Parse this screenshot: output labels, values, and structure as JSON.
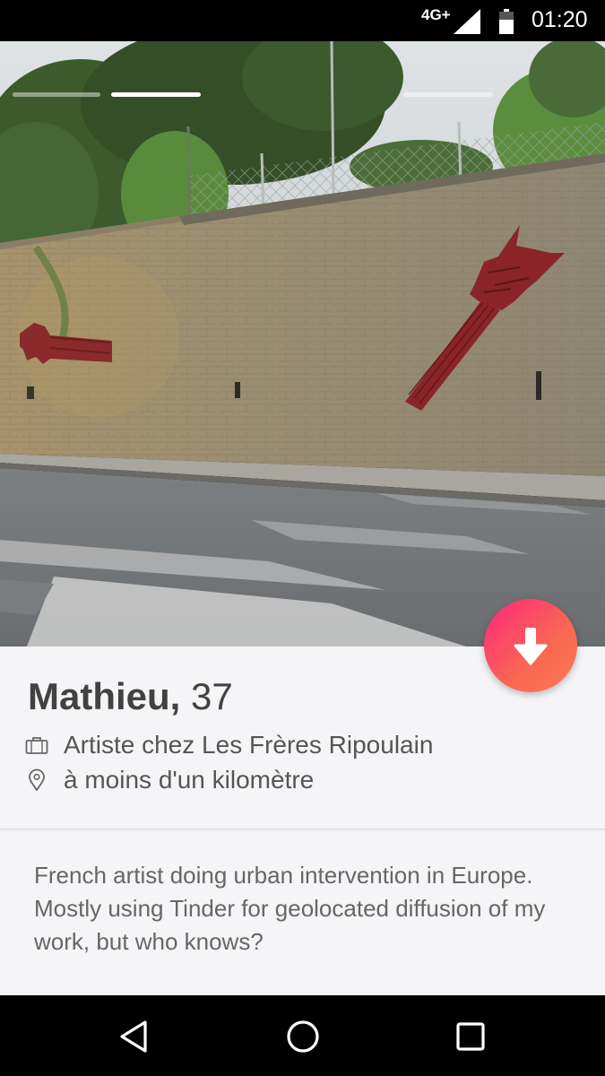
{
  "status_bar": {
    "network": "4G+",
    "time": "01:20",
    "signal_icon": "cell-signal-icon",
    "battery_icon": "battery-icon"
  },
  "profile": {
    "name": "Mathieu,",
    "age": "37",
    "job": "Artiste chez Les Frères Ripoulain",
    "distance": "à moins d'un kilomètre",
    "bio": "French artist doing urban intervention in Europe. Mostly using Tinder for geolocated diffusion of my work, but who knows?"
  },
  "photo_indicators": {
    "count": 3,
    "active_index": 1
  },
  "icons": {
    "job": "briefcase-icon",
    "distance": "location-pin-icon",
    "collapse": "arrow-down-icon",
    "back": "back-triangle-icon",
    "home": "home-circle-icon",
    "recents": "recents-square-icon"
  },
  "colors": {
    "accent_start": "#fd267d",
    "accent_end": "#ff7854",
    "panel_bg": "#f5f5f7",
    "name_text": "#424242"
  }
}
